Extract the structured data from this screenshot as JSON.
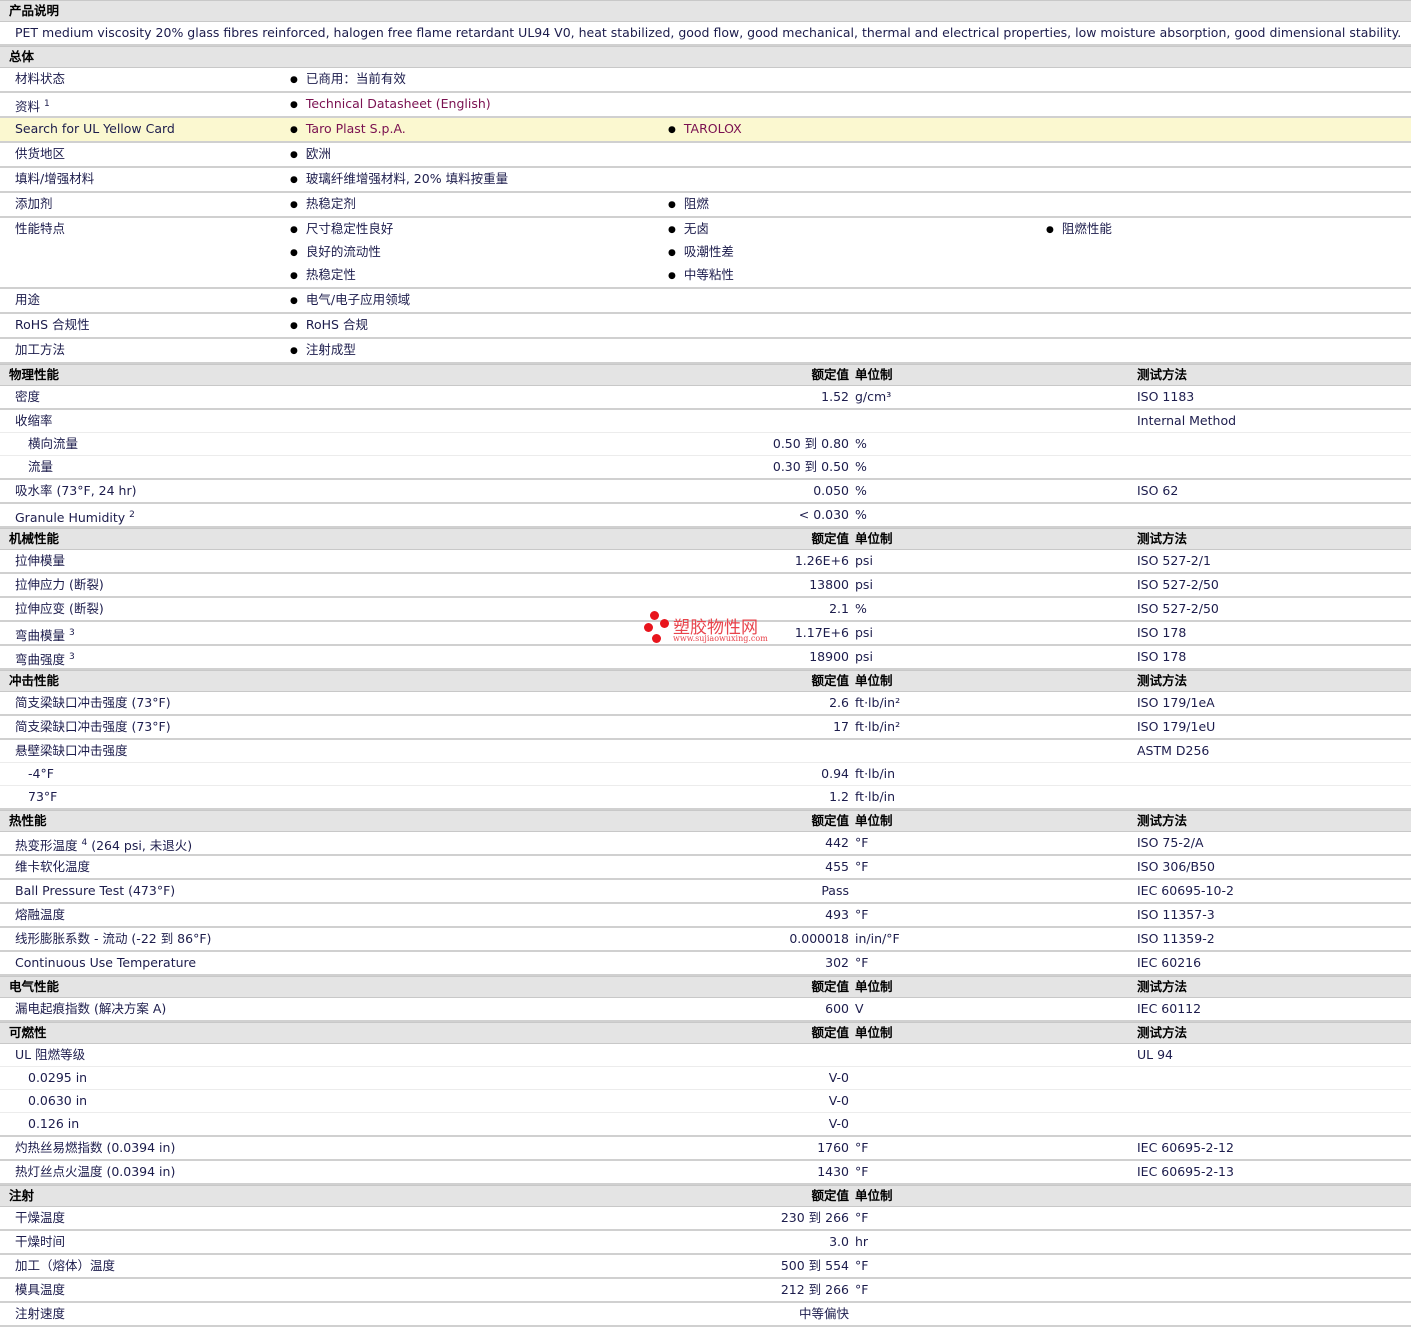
{
  "description": {
    "title": "产品说明",
    "text": "PET medium viscosity 20% glass fibres reinforced, halogen free flame retardant UL94 V0, heat stabilized, good flow, good mechanical, thermal and electrical properties, low moisture absorption, good dimensional stability."
  },
  "general": {
    "title": "总体",
    "rows": [
      {
        "label": "材料状态",
        "items": [
          "已商用：当前有效"
        ]
      },
      {
        "label": "资料",
        "sup": "1",
        "items": [
          "Technical Datasheet (English)"
        ],
        "link": true
      },
      {
        "label": "Search for UL Yellow Card",
        "items": [
          "Taro Plast S.p.A.",
          "TAROLOX"
        ],
        "link": true,
        "highlight": true
      },
      {
        "label": "供货地区",
        "items": [
          "欧洲"
        ]
      },
      {
        "label": "填料/增强材料",
        "items": [
          "玻璃纤维增强材料, 20% 填料按重量"
        ]
      },
      {
        "label": "添加剂",
        "items": [
          "热稳定剂",
          "阻燃"
        ]
      },
      {
        "label": "性能特点",
        "items": [
          "尺寸稳定性良好",
          "无卤",
          "阻燃性能",
          "良好的流动性",
          "吸潮性差",
          "",
          "热稳定性",
          "中等粘性",
          ""
        ]
      },
      {
        "label": "用途",
        "items": [
          "电气/电子应用领域"
        ]
      },
      {
        "label": "RoHS 合规性",
        "items": [
          "RoHS 合规"
        ]
      },
      {
        "label": "加工方法",
        "items": [
          "注射成型"
        ]
      }
    ]
  },
  "columns": {
    "value": "额定值",
    "unit": "单位制",
    "method": "测试方法"
  },
  "sections": [
    {
      "title": "物理性能",
      "rows": [
        {
          "label": "密度",
          "value": "1.52",
          "unit": "g/cm³",
          "method": "ISO 1183"
        },
        {
          "label": "收缩率",
          "value": "",
          "unit": "",
          "method": "Internal Method",
          "subnext": true
        },
        {
          "label": "横向流量",
          "sub": true,
          "value": "0.50 到  0.80",
          "unit": "%",
          "method": "",
          "subnext": true
        },
        {
          "label": "流量",
          "sub": true,
          "value": "0.30 到  0.50",
          "unit": "%",
          "method": ""
        },
        {
          "label": "吸水率  (73°F, 24 hr)",
          "value": "0.050",
          "unit": "%",
          "method": "ISO 62"
        },
        {
          "label": "Granule Humidity",
          "sup": "2",
          "value": "< 0.030",
          "unit": "%",
          "method": ""
        }
      ]
    },
    {
      "title": "机械性能",
      "rows": [
        {
          "label": "拉伸模量",
          "value": "1.26E+6",
          "unit": "psi",
          "method": "ISO 527-2/1"
        },
        {
          "label": "拉伸应力  (断裂)",
          "value": "13800",
          "unit": "psi",
          "method": "ISO 527-2/50"
        },
        {
          "label": "拉伸应变  (断裂)",
          "value": "2.1",
          "unit": "%",
          "method": "ISO 527-2/50"
        },
        {
          "label": "弯曲模量",
          "sup": "3",
          "value": "1.17E+6",
          "unit": "psi",
          "method": "ISO 178"
        },
        {
          "label": "弯曲强度",
          "sup": "3",
          "value": "18900",
          "unit": "psi",
          "method": "ISO 178"
        }
      ]
    },
    {
      "title": "冲击性能",
      "rows": [
        {
          "label": "简支梁缺口冲击强度  (73°F)",
          "value": "2.6",
          "unit": "ft·lb/in²",
          "method": "ISO 179/1eA"
        },
        {
          "label": "简支梁缺口冲击强度  (73°F)",
          "value": "17",
          "unit": "ft·lb/in²",
          "method": "ISO 179/1eU"
        },
        {
          "label": "悬壁梁缺口冲击强度",
          "value": "",
          "unit": "",
          "method": "ASTM D256",
          "subnext": true
        },
        {
          "label": "-4°F",
          "sub": true,
          "value": "0.94",
          "unit": "ft·lb/in",
          "method": "",
          "subnext": true
        },
        {
          "label": "73°F",
          "sub": true,
          "value": "1.2",
          "unit": "ft·lb/in",
          "method": ""
        }
      ]
    },
    {
      "title": "热性能",
      "rows": [
        {
          "label": "热变形温度",
          "sup": "4",
          "cond": " (264 psi, 未退火)",
          "value": "442",
          "unit": "°F",
          "method": "ISO 75-2/A"
        },
        {
          "label": "维卡软化温度",
          "value": "455",
          "unit": "°F",
          "method": "ISO 306/B50"
        },
        {
          "label": "Ball Pressure Test (473°F)",
          "value": "Pass",
          "unit": "",
          "method": "IEC 60695-10-2"
        },
        {
          "label": "熔融温度",
          "value": "493",
          "unit": "°F",
          "method": "ISO 11357-3"
        },
        {
          "label": "线形膨胀系数  - 流动  (-22 到  86°F)",
          "value": "0.000018",
          "unit": "in/in/°F",
          "method": "ISO 11359-2"
        },
        {
          "label": "Continuous Use Temperature",
          "value": "302",
          "unit": "°F",
          "method": "IEC 60216"
        }
      ]
    },
    {
      "title": "电气性能",
      "rows": [
        {
          "label": "漏电起痕指数  (解决方案  A)",
          "value": "600",
          "unit": "V",
          "method": "IEC 60112"
        }
      ]
    },
    {
      "title": "可燃性",
      "rows": [
        {
          "label": "UL 阻燃等级",
          "value": "",
          "unit": "",
          "method": "UL 94",
          "subnext": true
        },
        {
          "label": "0.0295 in",
          "sub": true,
          "value": "V-0",
          "unit": "",
          "method": "",
          "subnext": true
        },
        {
          "label": "0.0630 in",
          "sub": true,
          "value": "V-0",
          "unit": "",
          "method": "",
          "subnext": true
        },
        {
          "label": "0.126 in",
          "sub": true,
          "value": "V-0",
          "unit": "",
          "method": ""
        },
        {
          "label": "灼热丝易燃指数  (0.0394 in)",
          "value": "1760",
          "unit": "°F",
          "method": "IEC 60695-2-12"
        },
        {
          "label": "热灯丝点火温度  (0.0394 in)",
          "value": "1430",
          "unit": "°F",
          "method": "IEC 60695-2-13"
        }
      ]
    },
    {
      "title": "注射",
      "nomethod": true,
      "rows": [
        {
          "label": "干燥温度",
          "value": "230 到  266",
          "unit": "°F",
          "method": ""
        },
        {
          "label": "干燥时间",
          "value": "3.0",
          "unit": "hr",
          "method": ""
        },
        {
          "label": "加工（熔体）温度",
          "value": "500 到  554",
          "unit": "°F",
          "method": ""
        },
        {
          "label": "模具温度",
          "value": "212 到  266",
          "unit": "°F",
          "method": ""
        },
        {
          "label": "注射速度",
          "value": "中等偏快",
          "unit": "",
          "method": ""
        }
      ]
    }
  ],
  "watermark": {
    "name": "塑胶物性网",
    "url": "www.sujiaowuxing.com",
    "color": "#e8141c"
  }
}
